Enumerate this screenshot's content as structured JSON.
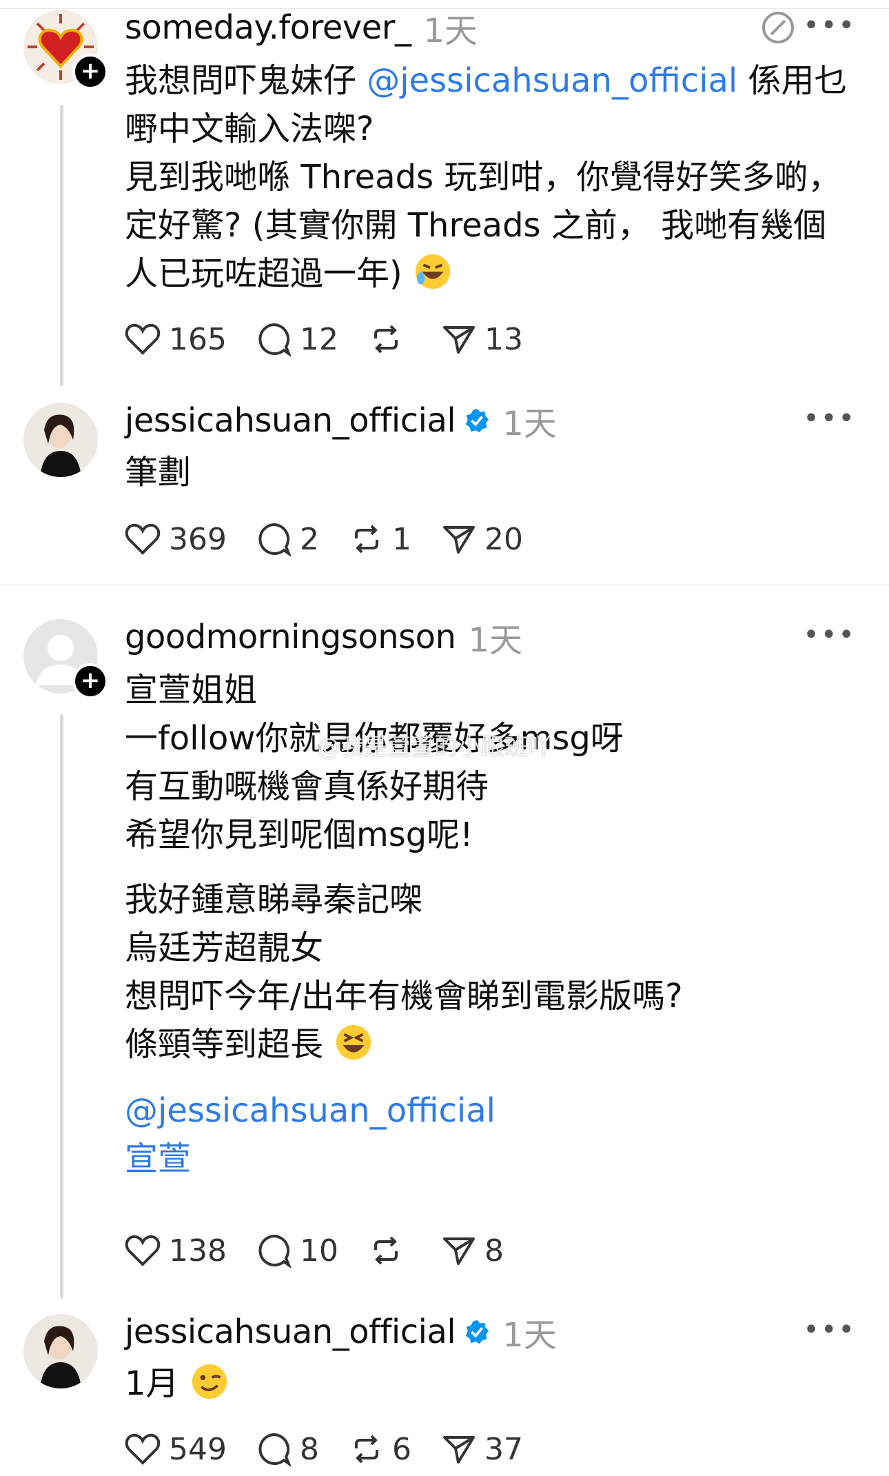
{
  "posts": [
    {
      "username": "someday.forever_",
      "time": "1天",
      "lines": [
        {
          "pre": "我想問吓鬼妹仔 ",
          "mention": "@jessicahsuan_official",
          "post": " 係用乜"
        },
        {
          "text": "嘢中文輸入法㗎?"
        },
        {
          "text": "見到我哋喺 Threads 玩到咁，你覺得好笑多啲，"
        },
        {
          "text": "定好驚? (其實你開 Threads 之前， 我哋有幾個"
        },
        {
          "text": "人已玩咗超過一年)"
        }
      ],
      "likes": "165",
      "replies": "12",
      "reposts": "",
      "shares": "13"
    },
    {
      "username": "jessicahsuan_official",
      "time": "1天",
      "lines": [
        {
          "text": "筆劃"
        }
      ],
      "likes": "369",
      "replies": "2",
      "reposts": "1",
      "shares": "20"
    },
    {
      "username": "goodmorningsonson",
      "time": "1天",
      "lines": [
        {
          "text": "宣萱姐姐"
        },
        {
          "text": "一follow你就見你都覆好多msg呀"
        },
        {
          "text": "有互動嘅機會真係好期待"
        },
        {
          "text": "希望你見到呢個msg呢!"
        },
        {
          "text": "我好鍾意睇尋秦記㗎"
        },
        {
          "text": "烏廷芳超靚女"
        },
        {
          "text": "想問吓今年/出年有機會睇到電影版嗎?"
        },
        {
          "text": "條頸等到超長"
        },
        {
          "mention": "@jessicahsuan_official"
        },
        {
          "mention": "宣萱"
        }
      ],
      "likes": "138",
      "replies": "10",
      "reposts": "",
      "shares": "8"
    },
    {
      "username": "jessicahsuan_official",
      "time": "1天",
      "lines": [
        {
          "text": "1月"
        }
      ],
      "likes": "549",
      "replies": "8",
      "reposts": "6",
      "shares": "37"
    }
  ],
  "icons": {
    "like": "heart-icon",
    "reply": "comment-icon",
    "repost": "repost-icon",
    "share": "share-icon",
    "more": "more-icon",
    "verified": "verified-badge-icon",
    "follow": "plus-icon",
    "edit": "edit-icon"
  },
  "colors": {
    "mention": "#2e7be6",
    "verified": "#0095f6",
    "muted": "#9a9a9a"
  },
  "watermark": "@我是萱萱的小跟班吖"
}
